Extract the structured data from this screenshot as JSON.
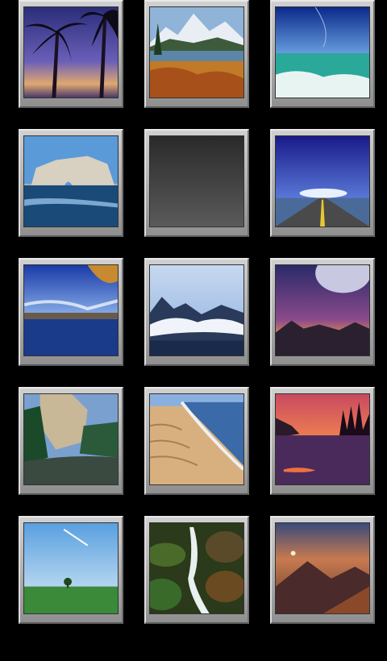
{
  "gallery": {
    "thumbnails": [
      {
        "subject": "palm-trees-sunset"
      },
      {
        "subject": "mountain-lake-autumn"
      },
      {
        "subject": "ocean-wave-sky"
      },
      {
        "subject": "sea-rock-arch"
      },
      {
        "subject": "blank-placeholder"
      },
      {
        "subject": "open-road-horizon"
      },
      {
        "subject": "autumn-lake-shore"
      },
      {
        "subject": "mountains-above-clouds"
      },
      {
        "subject": "planet-sunrise"
      },
      {
        "subject": "cliff-river-forest"
      },
      {
        "subject": "sand-dunes-beach"
      },
      {
        "subject": "sunset-lake-reflection"
      },
      {
        "subject": "green-field-tree"
      },
      {
        "subject": "forest-waterfall"
      },
      {
        "subject": "misty-mountain-sunset"
      }
    ]
  }
}
